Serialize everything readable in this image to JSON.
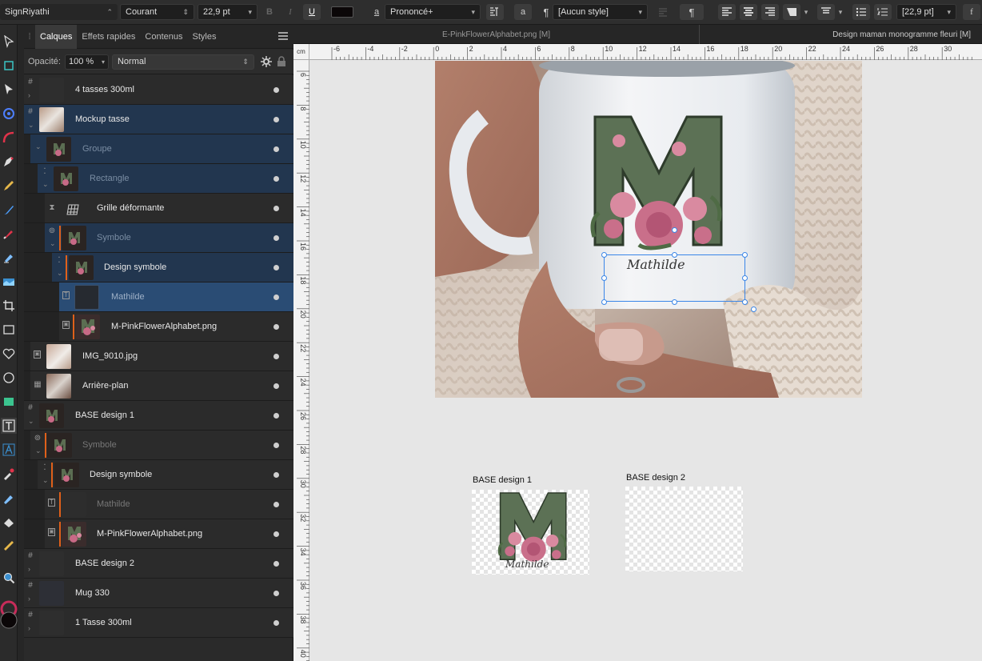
{
  "toolbar": {
    "font_family": "SignRiyathi",
    "font_style": "Courant",
    "font_size": "22,9 pt",
    "bold": "B",
    "italic": "I",
    "underline": "U",
    "text_color": "#0b0708",
    "underline_style": "Prononcé+",
    "paragraph_style": "[Aucun style]",
    "leading": "[22,9 pt]"
  },
  "layers_panel": {
    "tabs": [
      "Calques",
      "Effets rapides",
      "Contenus",
      "Styles"
    ],
    "active_tab": "Calques",
    "opacity_label": "Opacité:",
    "opacity_value": "100 %",
    "blend_mode": "Normal",
    "layers": [
      {
        "name": "4 tasses 300ml"
      },
      {
        "name": "Mockup tasse"
      },
      {
        "name": "Groupe"
      },
      {
        "name": "Rectangle"
      },
      {
        "name": "Grille déformante"
      },
      {
        "name": "Symbole"
      },
      {
        "name": "Design symbole"
      },
      {
        "name": "Mathilde"
      },
      {
        "name": "M-PinkFlowerAlphabet.png"
      },
      {
        "name": "IMG_9010.jpg"
      },
      {
        "name": "Arrière-plan"
      },
      {
        "name": "BASE design 1"
      },
      {
        "name": "Symbole"
      },
      {
        "name": "Design symbole"
      },
      {
        "name": "Mathilde"
      },
      {
        "name": "M-PinkFlowerAlphabet.png"
      },
      {
        "name": "BASE design 2"
      },
      {
        "name": "Mug 330"
      },
      {
        "name": "1 Tasse 300ml"
      }
    ]
  },
  "document": {
    "tab1": "E-PinkFlowerAlphabet.png [M]",
    "tab2": "Design maman monogramme fleuri [M]",
    "unit": "cm",
    "h_ticks": [
      "-6",
      "-4",
      "-2",
      "0",
      "2",
      "4",
      "6",
      "8",
      "10",
      "12",
      "14",
      "16",
      "18",
      "20",
      "22",
      "24",
      "26",
      "28",
      "30"
    ],
    "v_ticks": [
      "6",
      "8",
      "10",
      "12",
      "14",
      "16",
      "18",
      "20",
      "22",
      "24",
      "26",
      "28",
      "30",
      "32",
      "34",
      "36",
      "38",
      "40"
    ]
  },
  "canvas": {
    "mug_text": "Mathilde",
    "artboard1_label": "BASE design 1",
    "artboard2_label": "BASE design 2",
    "artboard1_text": "Mathilde"
  }
}
